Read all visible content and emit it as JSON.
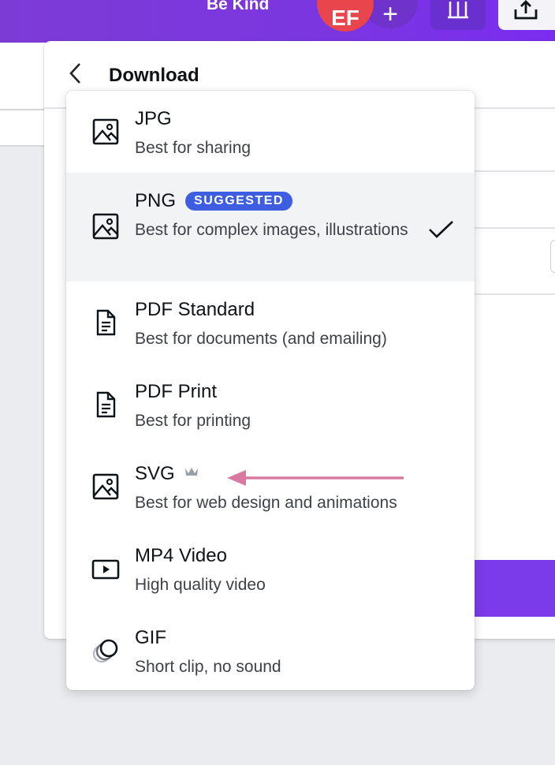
{
  "topbar": {
    "title": "Be Kind",
    "avatar_initials": "EF",
    "add_label": "+"
  },
  "panel": {
    "back_icon": "chevron-left-icon",
    "heading": "Download"
  },
  "formats": [
    {
      "name": "JPG",
      "description": "Best for sharing",
      "icon": "image-icon"
    },
    {
      "name": "PNG",
      "badge": "SUGGESTED",
      "description": "Best for complex images, illustrations",
      "icon": "image-icon",
      "selected": true
    },
    {
      "name": "PDF Standard",
      "description": "Best for documents (and emailing)",
      "icon": "document-icon"
    },
    {
      "name": "PDF Print",
      "description": "Best for printing",
      "icon": "document-icon"
    },
    {
      "name": "SVG",
      "pro_icon": "crown-icon",
      "description": "Best for web design and animations",
      "icon": "image-icon"
    },
    {
      "name": "MP4 Video",
      "description": "High quality video",
      "icon": "video-play-icon"
    },
    {
      "name": "GIF",
      "description": "Short clip, no sound",
      "icon": "gif-circles-icon"
    }
  ],
  "colors": {
    "topbar": "#7b36e0",
    "badge": "#3d5ee1",
    "avatar": "#e8464c",
    "annotation_arrow": "#d9799f",
    "download_button": "#7b3bea"
  }
}
